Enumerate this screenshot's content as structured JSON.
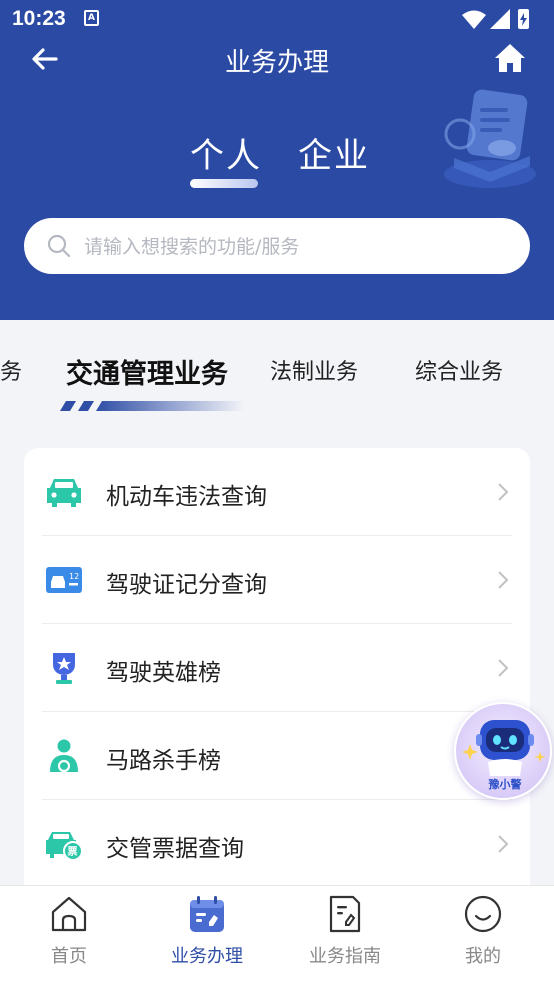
{
  "status_bar": {
    "time": "10:23",
    "badge": "A"
  },
  "nav": {
    "title": "业务办理"
  },
  "segments": [
    {
      "label": "个人",
      "active": true
    },
    {
      "label": "企业",
      "active": false
    }
  ],
  "search": {
    "placeholder": "请输入想搜索的功能/服务"
  },
  "categories": [
    {
      "label": "业务",
      "active": false
    },
    {
      "label": "交通管理业务",
      "active": true
    },
    {
      "label": "法制业务",
      "active": false
    },
    {
      "label": "综合业务",
      "active": false
    }
  ],
  "services": [
    {
      "label": "机动车违法查询",
      "icon": "car-icon"
    },
    {
      "label": "驾驶证记分查询",
      "icon": "license-card-icon"
    },
    {
      "label": "驾驶英雄榜",
      "icon": "trophy-icon"
    },
    {
      "label": "马路杀手榜",
      "icon": "driver-person-icon"
    },
    {
      "label": "交管票据查询",
      "icon": "car-ticket-icon"
    }
  ],
  "assistant": {
    "label": "豫小警"
  },
  "tabbar": [
    {
      "label": "首页",
      "icon": "home-outline-icon",
      "active": false
    },
    {
      "label": "业务办理",
      "icon": "business-handling-icon",
      "active": true
    },
    {
      "label": "业务指南",
      "icon": "guide-document-icon",
      "active": false
    },
    {
      "label": "我的",
      "icon": "smiley-profile-icon",
      "active": false
    }
  ],
  "colors": {
    "header": "#2b4aa4",
    "accent": "#2f4ea6",
    "teal_icon": "#2cc6a8",
    "blue_icon": "#3a7be8"
  }
}
